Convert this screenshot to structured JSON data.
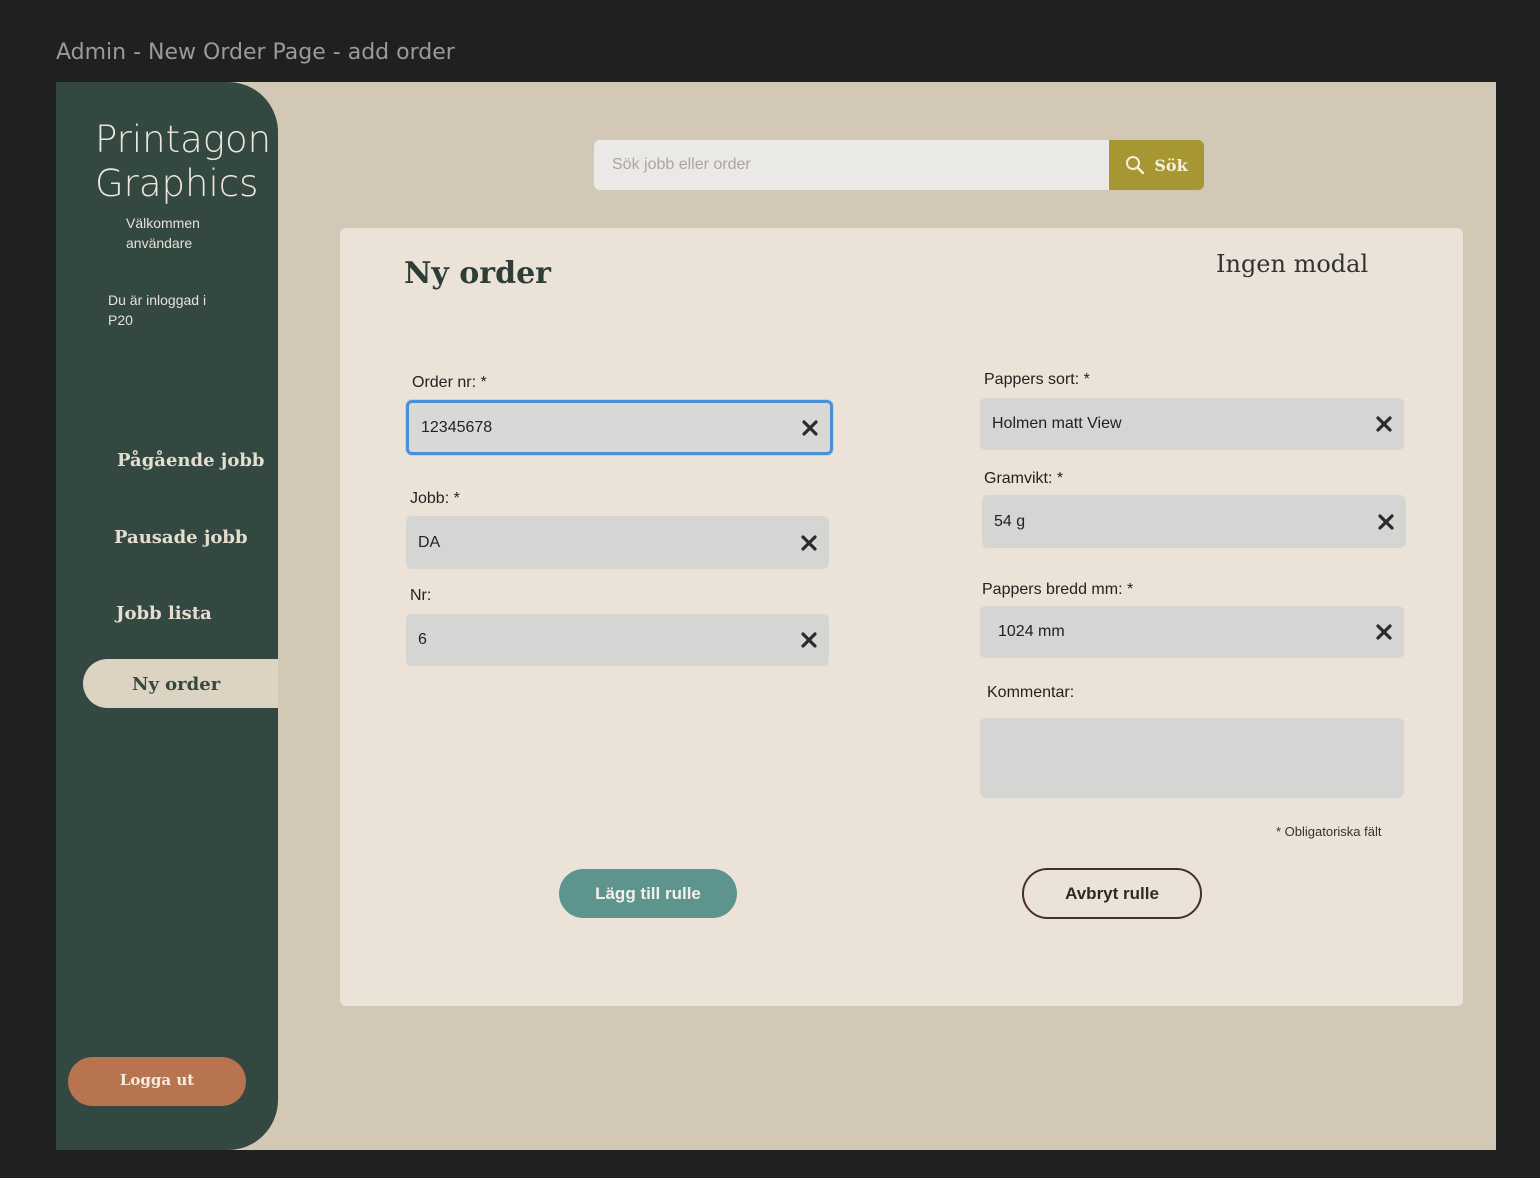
{
  "frame": {
    "title": "Admin - New Order Page - add order"
  },
  "sidebar": {
    "brand": "Printagon Graphics",
    "welcome": "Välkommen användare",
    "logged_in": "Du är inloggad i P20",
    "nav": [
      {
        "label": "Pågående jobb"
      },
      {
        "label": "Pausade jobb"
      },
      {
        "label": "Jobb lista"
      },
      {
        "label": "Ny order",
        "active": true
      }
    ],
    "logout": "Logga ut"
  },
  "search": {
    "placeholder": "Sök jobb eller order",
    "button": "Sök"
  },
  "form": {
    "title": "Ny order",
    "modal_label": "Ingen modal",
    "fields": {
      "order_nr": {
        "label": "Order nr: *",
        "value": "12345678"
      },
      "jobb": {
        "label": "Jobb: *",
        "value": "DA"
      },
      "nr": {
        "label": "Nr:",
        "value": "6"
      },
      "pappers_sort": {
        "label": "Pappers sort: *",
        "value": "Holmen matt View"
      },
      "gramvikt": {
        "label": "Gramvikt: *",
        "value": "54 g"
      },
      "pappers_bredd": {
        "label": "Pappers bredd mm: *",
        "value": "1024 mm"
      },
      "kommentar": {
        "label": "Kommentar:",
        "value": ""
      }
    },
    "required_note": "* Obligatoriska fält",
    "add_button": "Lägg till rulle",
    "cancel_button": "Avbryt rulle"
  },
  "colors": {
    "sidebar": "#334840",
    "canvas": "#d3c7b5",
    "card": "#ebe3d8",
    "search_button": "#a69733",
    "logout": "#b8734f",
    "add_button": "#5e948e",
    "focus_border": "#4a90d9"
  }
}
